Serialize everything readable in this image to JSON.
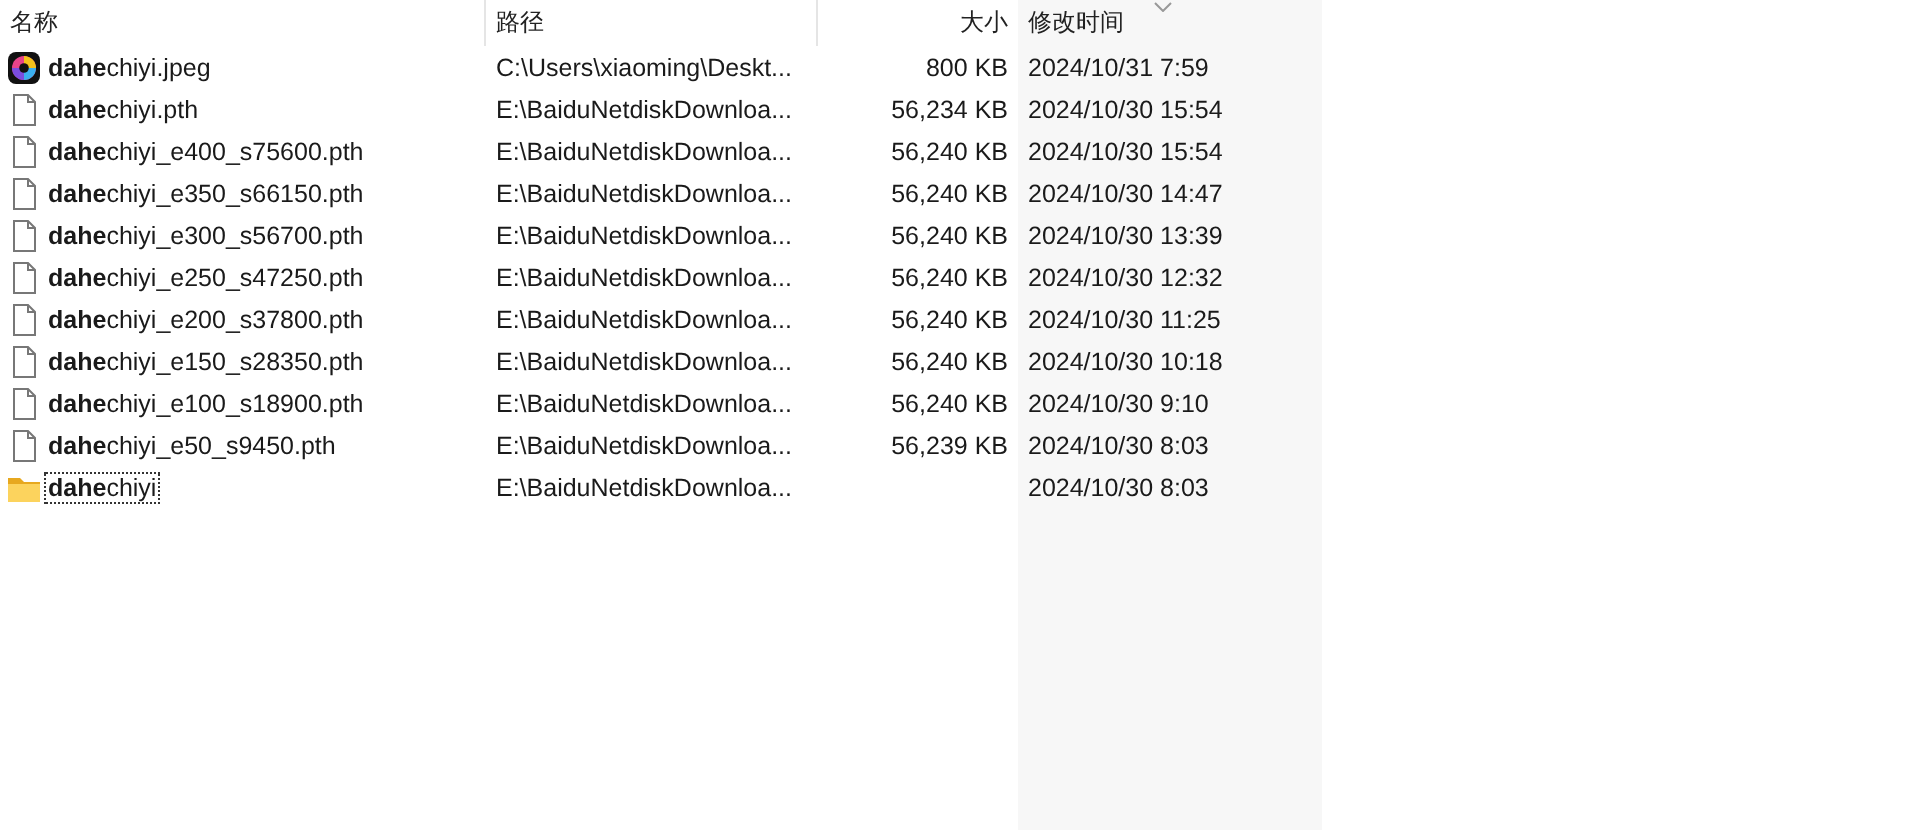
{
  "columns": [
    {
      "label": "名称",
      "sorted": false
    },
    {
      "label": "路径",
      "sorted": false
    },
    {
      "label": "大小",
      "sorted": false
    },
    {
      "label": "修改时间",
      "sorted": true
    }
  ],
  "rows": [
    {
      "kind": "image",
      "name": "**dahe**chiyi.jpeg",
      "path": "C:\\Users\\xiaoming\\Deskt...",
      "size": "800 KB",
      "modified": "2024/10/31 7:59",
      "focused": false
    },
    {
      "kind": "file",
      "name": "**dahe**chiyi.pth",
      "path": "E:\\BaiduNetdiskDownloa...",
      "size": "56,234 KB",
      "modified": "2024/10/30 15:54",
      "focused": false
    },
    {
      "kind": "file",
      "name": "**dahe**chiyi_e400_s75600.pth",
      "path": "E:\\BaiduNetdiskDownloa...",
      "size": "56,240 KB",
      "modified": "2024/10/30 15:54",
      "focused": false
    },
    {
      "kind": "file",
      "name": "**dahe**chiyi_e350_s66150.pth",
      "path": "E:\\BaiduNetdiskDownloa...",
      "size": "56,240 KB",
      "modified": "2024/10/30 14:47",
      "focused": false
    },
    {
      "kind": "file",
      "name": "**dahe**chiyi_e300_s56700.pth",
      "path": "E:\\BaiduNetdiskDownloa...",
      "size": "56,240 KB",
      "modified": "2024/10/30 13:39",
      "focused": false
    },
    {
      "kind": "file",
      "name": "**dahe**chiyi_e250_s47250.pth",
      "path": "E:\\BaiduNetdiskDownloa...",
      "size": "56,240 KB",
      "modified": "2024/10/30 12:32",
      "focused": false
    },
    {
      "kind": "file",
      "name": "**dahe**chiyi_e200_s37800.pth",
      "path": "E:\\BaiduNetdiskDownloa...",
      "size": "56,240 KB",
      "modified": "2024/10/30 11:25",
      "focused": false
    },
    {
      "kind": "file",
      "name": "**dahe**chiyi_e150_s28350.pth",
      "path": "E:\\BaiduNetdiskDownloa...",
      "size": "56,240 KB",
      "modified": "2024/10/30 10:18",
      "focused": false
    },
    {
      "kind": "file",
      "name": "**dahe**chiyi_e100_s18900.pth",
      "path": "E:\\BaiduNetdiskDownloa...",
      "size": "56,240 KB",
      "modified": "2024/10/30 9:10",
      "focused": false
    },
    {
      "kind": "file",
      "name": "**dahe**chiyi_e50_s9450.pth",
      "path": "E:\\BaiduNetdiskDownloa...",
      "size": "56,239 KB",
      "modified": "2024/10/30 8:03",
      "focused": false
    },
    {
      "kind": "folder",
      "name": "**dahe**chiyi",
      "path": "E:\\BaiduNetdiskDownloa...",
      "modified": "2024/10/30 8:03",
      "focused": true
    }
  ]
}
